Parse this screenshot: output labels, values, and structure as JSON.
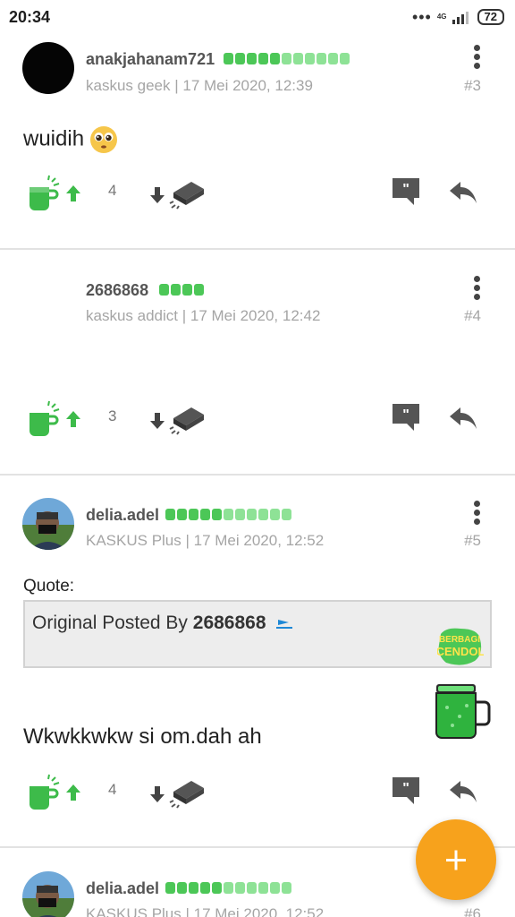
{
  "status_bar": {
    "time": "20:34",
    "network": "4G",
    "battery": "72"
  },
  "posts": [
    {
      "username": "anakjahanam721",
      "meta": "kaskus geek | 17 Mei 2020, 12:39",
      "number": "#3",
      "text": "wuidih",
      "emoji": "pleading-face-emoji",
      "cendol_count": "4"
    },
    {
      "username": "2686868",
      "meta": "kaskus addict | 17 Mei 2020, 12:42",
      "number": "#4",
      "text": "",
      "cendol_count": "3"
    },
    {
      "username": "delia.adel",
      "meta": "KASKUS Plus | 17 Mei 2020, 12:52",
      "number": "#5",
      "quote_label": "Quote:",
      "quote_prefix": "Original Posted By",
      "quote_author": "2686868",
      "sticker_text": "BERBAGI CENDOL",
      "text": "Wkwkkwkw si om.dah ah",
      "cendol_count": "4"
    },
    {
      "username": "delia.adel",
      "meta": "KASKUS Plus | 17 Mei 2020, 12:52",
      "number": "#6"
    }
  ],
  "colors": {
    "accent": "#f7a21c",
    "reputation": "#4cc757",
    "cendol_green": "#3dbb4a"
  },
  "fab": {
    "icon": "plus-icon"
  }
}
